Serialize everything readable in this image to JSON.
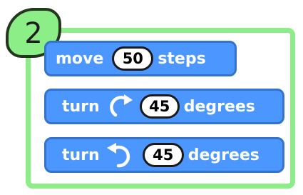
{
  "step": {
    "number": "2"
  },
  "blocks": [
    {
      "label_before": "move",
      "value": "50",
      "label_after": "steps"
    },
    {
      "label_before": "turn",
      "icon": "rotate-clockwise-icon",
      "value": "45",
      "label_after": "degrees"
    },
    {
      "label_before": "turn",
      "icon": "rotate-counterclockwise-icon",
      "value": "45",
      "label_after": "degrees"
    }
  ],
  "colors": {
    "block_fill": "#4c97ff",
    "block_border": "#3373cc",
    "panel_border": "#8cee86",
    "badge_fill": "#8cee86"
  }
}
